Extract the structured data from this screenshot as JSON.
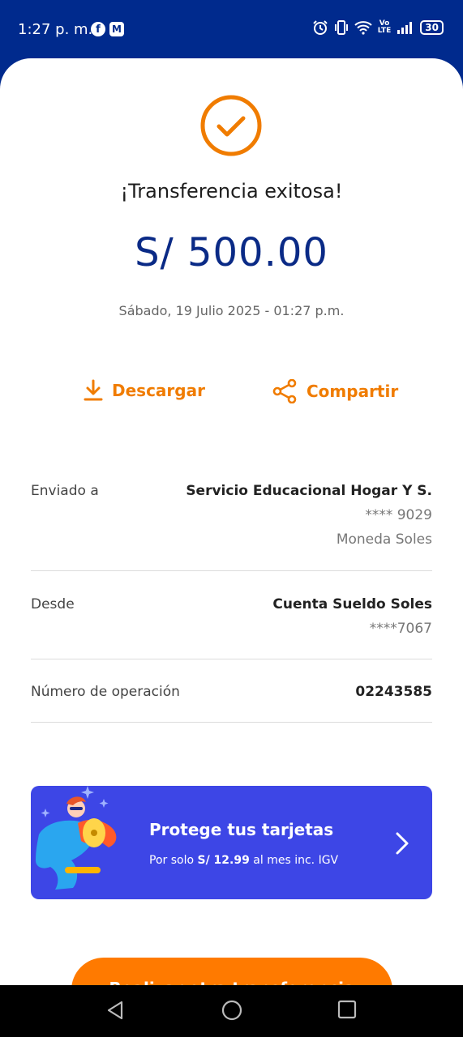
{
  "status_bar": {
    "time": "1:27 p. m.",
    "app_icons": [
      "facebook-icon",
      "mail-icon"
    ],
    "volte": "Vo\nLTE",
    "battery": "30"
  },
  "receipt": {
    "title": "¡Transferencia exitosa!",
    "amount": "S/ 500.00",
    "datetime": "Sábado, 19 Julio 2025 - 01:27 p.m.",
    "actions": {
      "download": "Descargar",
      "share": "Compartir"
    },
    "details": {
      "sent_to": {
        "label": "Enviado a",
        "name": "Servicio Educacional Hogar Y S.",
        "account": "**** 9029",
        "currency": "Moneda Soles"
      },
      "from": {
        "label": "Desde",
        "name": "Cuenta Sueldo Soles",
        "account": "****7067"
      },
      "operation": {
        "label": "Número de operación",
        "value": "02243585"
      }
    }
  },
  "promo": {
    "title": "Protege tus tarjetas",
    "sub_prefix": "Por solo ",
    "price": "S/ 12.99",
    "sub_suffix": " al mes inc. IGV"
  },
  "cta": {
    "label": "Realizar otra transferencia"
  },
  "colors": {
    "brand_blue": "#002a8d",
    "accent_orange": "#f07c00",
    "promo_blue": "#3d46e6"
  }
}
